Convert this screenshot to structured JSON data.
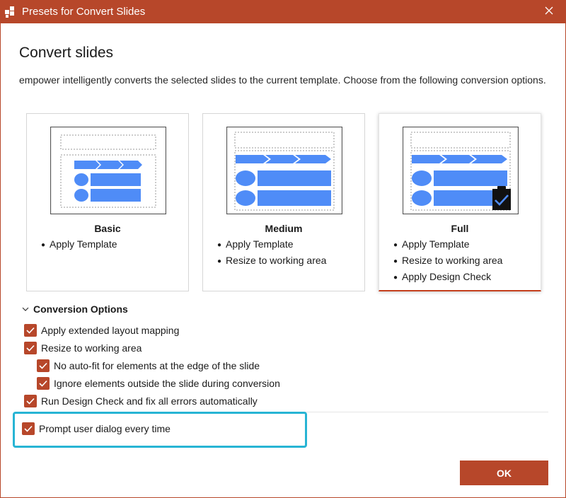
{
  "window": {
    "title": "Presets for Convert Slides",
    "close_icon": "close-icon",
    "accent_color": "#b7472a"
  },
  "heading": "Convert slides",
  "description": "empower intelligently converts the selected slides to the current template. Choose from the following conversion options.",
  "presets": [
    {
      "title": "Basic",
      "items": [
        "Apply Template"
      ],
      "selected": false
    },
    {
      "title": "Medium",
      "items": [
        "Apply Template",
        "Resize to working area"
      ],
      "selected": false
    },
    {
      "title": "Full",
      "items": [
        "Apply Template",
        "Resize to working area",
        "Apply Design Check"
      ],
      "selected": true
    }
  ],
  "options": {
    "header": "Conversion Options",
    "items": [
      {
        "label": "Apply extended layout mapping",
        "checked": true
      },
      {
        "label": "Resize to working area",
        "checked": true
      },
      {
        "label": "No auto-fit for elements at the edge of the slide",
        "checked": true
      },
      {
        "label": "Ignore elements outside the slide during conversion",
        "checked": true
      },
      {
        "label": "Run Design Check and fix all errors automatically",
        "checked": true
      }
    ],
    "prompt": {
      "label": "Prompt user dialog every time",
      "checked": true
    }
  },
  "ok_label": "OK",
  "highlight_color": "#27b4d4",
  "thumbnail_color": "#4f8cf7"
}
